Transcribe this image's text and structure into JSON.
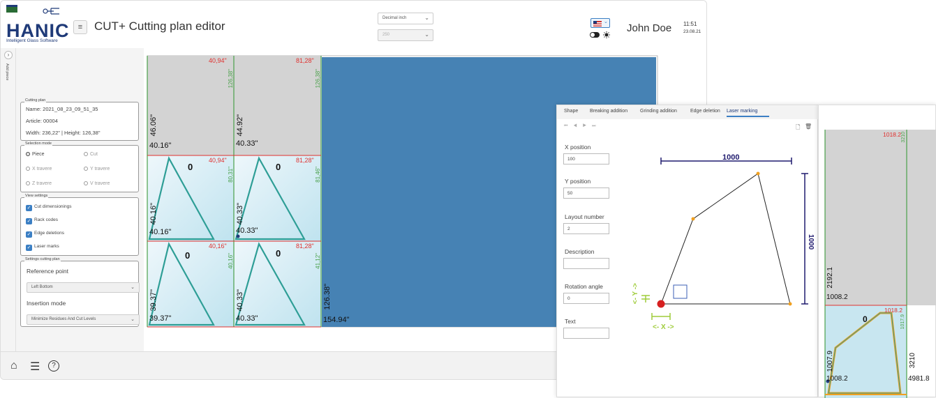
{
  "header": {
    "logo_word": "HANIC",
    "logo_sub": "Intelligent Glass Software",
    "title": "CUT+  Cutting plan editor",
    "unit_select": "Decimal inch",
    "second_select": "250",
    "user": "John Doe",
    "time": "11:51",
    "date": "23.08.21"
  },
  "sidebar": {
    "add_piece_label": "Add piece"
  },
  "cutting_plan": {
    "title": "Cutting plan",
    "name": "Name: 2021_08_23_09_51_35",
    "article": "Article: 00004",
    "size": "Width: 236,22\" | Height: 126,38\""
  },
  "selection_mode": {
    "title": "Selection mode",
    "options": [
      "Piece",
      "Cut",
      "X travere",
      "Y travere",
      "Z travere",
      "V travere"
    ],
    "selected": "Piece"
  },
  "view_settings": {
    "title": "View settings",
    "options": [
      "Cut dimensionings",
      "Rack codes",
      "Edge deletions",
      "Laser marks"
    ]
  },
  "settings_cutting_plan": {
    "title": "Settings cutting plan",
    "reference_label": "Reference point",
    "reference_value": "Left Bottom",
    "insertion_label": "Insertion mode",
    "insertion_value": "Minimize Residues And Cut Levels"
  },
  "plan": {
    "top_left_width": "40,94\"",
    "top_left_height": "126,38\"",
    "top_mid_width": "81,28\"",
    "top_mid_height": "126,38\"",
    "col1_h1": "46.06\"",
    "col1_w1": "40.16\"",
    "col2_h1": "44.92\"",
    "col2_w1": "40.33\"",
    "p1_w": "40,94\"",
    "p1_h": "80,31\"",
    "p1_zero": "0",
    "p1_side": "40.16\"",
    "p1_bottom": "40.16\"",
    "p2_w": "81,28\"",
    "p2_h": "81,46\"",
    "p2_zero": "0",
    "p2_side": "40.33\"",
    "p2_bottom": "40.33\"",
    "p3_w": "40,16\"",
    "p3_h": "40,16\"",
    "p3_zero": "0",
    "p3_side": "39.37\"",
    "p3_bottom": "39.37\"",
    "p4_w": "81,28\"",
    "p4_h": "41,12\"",
    "p4_zero": "0",
    "p4_side": "40.33\"",
    "p4_bottom": "40.33\"",
    "total_h": "126.38\"",
    "total_w": "154.94\""
  },
  "footer": {
    "home": "⌂",
    "list": "☰",
    "help": "?"
  },
  "popup": {
    "tabs": [
      "Shape",
      "Breaking addition",
      "Grinding addition",
      "Edge deletion",
      "Laser marking"
    ],
    "active_tab": "Laser marking",
    "fields": [
      {
        "label": "X position",
        "value": "100"
      },
      {
        "label": "Y position",
        "value": "50"
      },
      {
        "label": "Layout number",
        "value": "2"
      },
      {
        "label": "Description",
        "value": ""
      },
      {
        "label": "Rotation angle",
        "value": "0"
      },
      {
        "label": "Text",
        "value": ""
      }
    ],
    "dim_top": "1000",
    "dim_right": "1000",
    "x_label": "<- X ->",
    "y_label": "<- Y ->"
  },
  "right_panel": {
    "top_red": "1018.2",
    "top_green": "3210",
    "side1": "2192.1",
    "w1": "1008.2",
    "piece_red": "1018.2",
    "piece_green": "1017.9",
    "piece_zero": "0",
    "piece_side": "1007.9",
    "piece_bottom": "1008.2",
    "piece_h": "3210",
    "piece_w": "4981.8"
  },
  "colors": {
    "accent": "#3b7fc4",
    "residue": "#4682b4",
    "red_dim": "#e0302e",
    "green_dim": "#4aa04a",
    "brand": "#1f3a78"
  }
}
